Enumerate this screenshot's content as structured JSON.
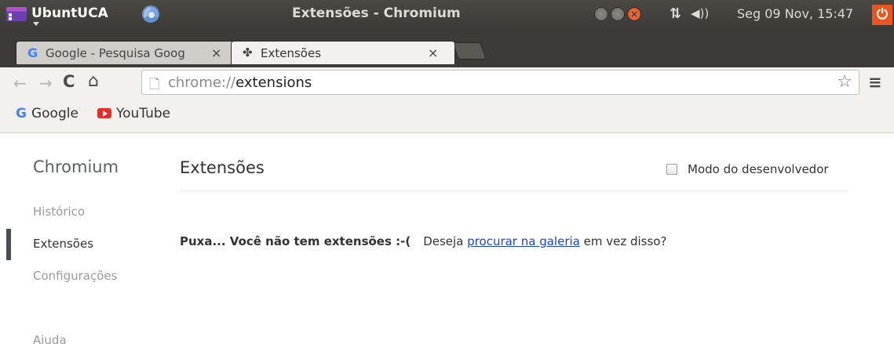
{
  "panel": {
    "app_name": "UbuntUCA",
    "window_title": "Extensões - Chromium",
    "close_glyph": "×",
    "net_glyph": "⇅",
    "volume_glyph": "◀))",
    "clock": "Seg 09 Nov, 15:47",
    "power_glyph": "⏻"
  },
  "tabs": [
    {
      "favicon": "G",
      "title": "Google - Pesquisa Goog",
      "close": "×"
    },
    {
      "favicon": "✤",
      "title": "Extensões",
      "close": "×"
    }
  ],
  "toolbar": {
    "back": "←",
    "forward": "→",
    "reload": "C",
    "home": "⌂",
    "url_scheme": "chrome://",
    "url_host": "extensions",
    "star": "☆",
    "menu": "≡"
  },
  "bookmarks": [
    {
      "icon": "G",
      "label": "Google"
    },
    {
      "icon": "youtube-icon",
      "label": "YouTube"
    }
  ],
  "sidebar": {
    "title": "Chromium",
    "items": [
      {
        "label": "Histórico"
      },
      {
        "label": "Extensões"
      },
      {
        "label": "Configurações"
      },
      {
        "label": "Ajuda"
      }
    ]
  },
  "main": {
    "title": "Extensões",
    "dev_mode_label": "Modo do desenvolvedor",
    "empty_strong": "Puxa... Você não tem extensões :-(",
    "empty_prefix": "Deseja ",
    "empty_link": "procurar na galeria",
    "empty_suffix": " em vez disso?"
  }
}
